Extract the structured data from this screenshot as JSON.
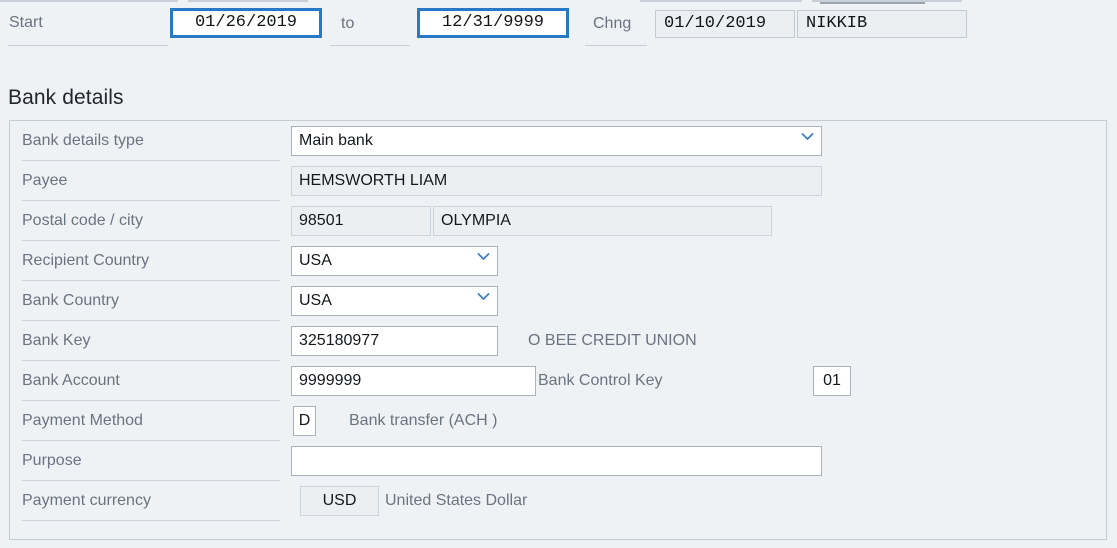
{
  "validity": {
    "start_label": "Start",
    "start_value": "01/26/2019",
    "to_label": "to",
    "end_value": "12/31/9999",
    "chng_label": "Chng",
    "chng_date": "01/10/2019",
    "chng_user": "NIKKIB"
  },
  "section": {
    "title": "Bank details"
  },
  "form": {
    "bank_details_type": {
      "label": "Bank details type",
      "value": "Main bank"
    },
    "payee": {
      "label": "Payee",
      "value": "HEMSWORTH LIAM"
    },
    "postal_city": {
      "label": "Postal code / city",
      "postal_value": "98501",
      "city_value": "OLYMPIA"
    },
    "recipient_country": {
      "label": "Recipient Country",
      "value": "USA"
    },
    "bank_country": {
      "label": "Bank Country",
      "value": "USA"
    },
    "bank_key": {
      "label": "Bank Key",
      "value": "325180977",
      "description": "O BEE CREDIT UNION"
    },
    "bank_account": {
      "label": "Bank Account",
      "value": "9999999",
      "control_key_label": "Bank Control Key",
      "control_key_value": "01"
    },
    "payment_method": {
      "label": "Payment Method",
      "value": "D",
      "description": "Bank transfer (ACH )"
    },
    "purpose": {
      "label": "Purpose",
      "value": ""
    },
    "payment_currency": {
      "label": "Payment currency",
      "value": "USD",
      "description": "United States Dollar"
    }
  },
  "colors": {
    "focus_blue": "#2878c8",
    "chevron_blue": "#3f7fbf",
    "background": "#eff2f5",
    "label_grey": "#6a7480"
  }
}
